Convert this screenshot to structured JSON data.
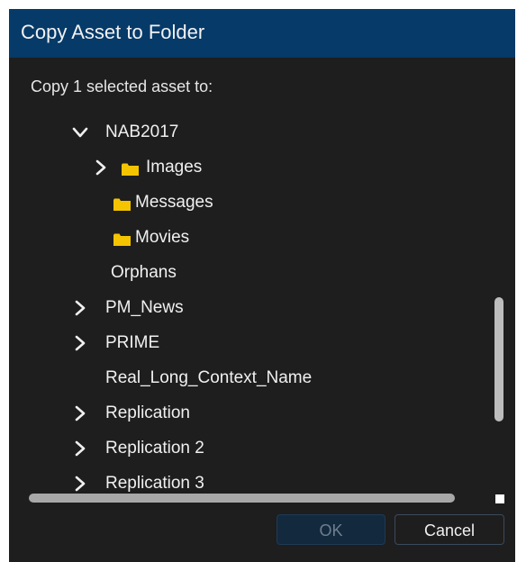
{
  "dialog": {
    "title": "Copy Asset to Folder",
    "prompt": "Copy 1 selected asset to:",
    "ok_label": "OK",
    "cancel_label": "Cancel",
    "ok_enabled": false
  },
  "tree": {
    "items": [
      {
        "label": "NAB2017",
        "chevron": "chevron-down-icon",
        "icon": null,
        "level": 0
      },
      {
        "label": "Images",
        "chevron": "chevron-right-icon",
        "icon": "folder-icon",
        "level": 1
      },
      {
        "label": "Messages",
        "chevron": null,
        "icon": "folder-icon",
        "level": 1
      },
      {
        "label": "Movies",
        "chevron": null,
        "icon": "folder-icon",
        "level": 1
      },
      {
        "label": "Orphans",
        "chevron": null,
        "icon": null,
        "level": 1
      },
      {
        "label": "PM_News",
        "chevron": "chevron-right-icon",
        "icon": null,
        "level": 0
      },
      {
        "label": "PRIME",
        "chevron": "chevron-right-icon",
        "icon": null,
        "level": 0
      },
      {
        "label": "Real_Long_Context_Name",
        "chevron": null,
        "icon": null,
        "level": 0
      },
      {
        "label": "Replication",
        "chevron": "chevron-right-icon",
        "icon": null,
        "level": 0
      },
      {
        "label": "Replication 2",
        "chevron": "chevron-right-icon",
        "icon": null,
        "level": 0
      },
      {
        "label": "Replication 3",
        "chevron": "chevron-right-icon",
        "icon": null,
        "level": 0
      }
    ]
  },
  "colors": {
    "title_bar": "#063a68",
    "dialog_bg": "#1e1e1e",
    "folder": "#f5c400",
    "text": "#f0f0f0"
  }
}
